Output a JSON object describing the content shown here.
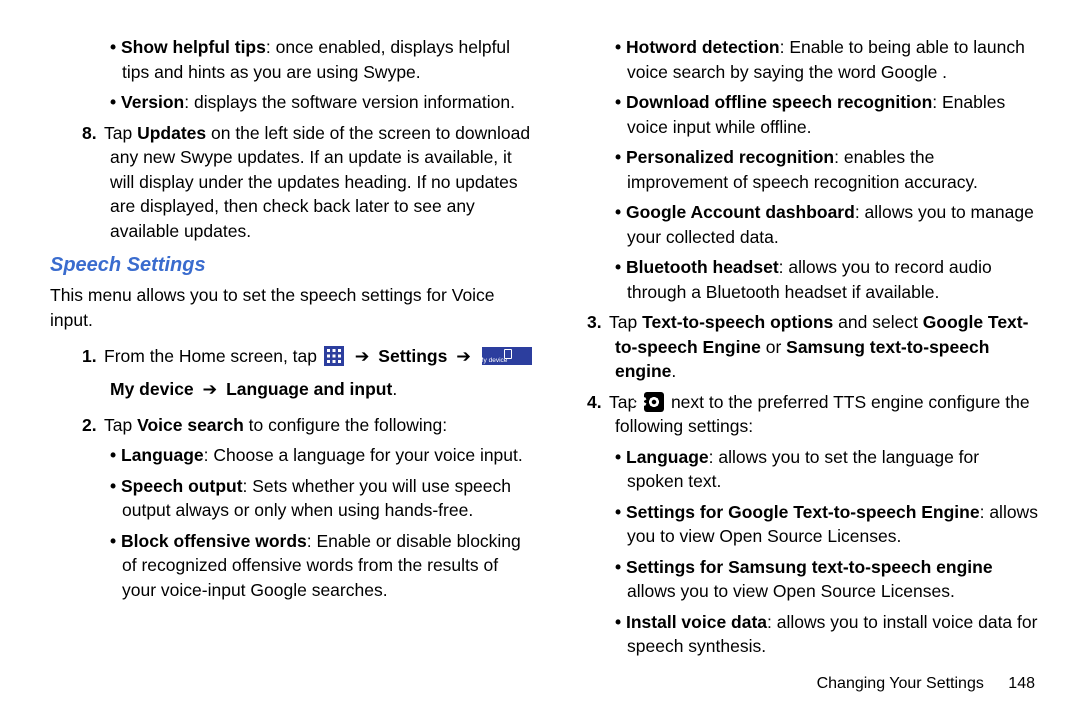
{
  "left": {
    "b1_bold": "Show helpful tips",
    "b1_rest": ": once enabled, displays helpful tips and hints as you are using Swype.",
    "b2_bold": "Version",
    "b2_rest": ": displays the software version information.",
    "n8_num": "8.",
    "n8_a": "Tap ",
    "n8_b": "Updates",
    "n8_c": " on the left side of the screen to download any new Swype updates. If an update is available, it will display under the updates heading. If no updates are displayed, then check back later to see any available updates.",
    "heading": "Speech Settings",
    "intro": "This menu allows you to set the speech settings for Voice input.",
    "n1_num": "1.",
    "n1_a": "From the Home screen, tap ",
    "n1_settings": "Settings",
    "n1_mydevice": "My device",
    "n1_langinput": "Language and input",
    "n2_num": "2.",
    "n2_a": "Tap ",
    "n2_b": "Voice search",
    "n2_c": " to configure the following:",
    "vb1_bold": "Language",
    "vb1_rest": ": Choose a language for your voice input.",
    "vb2_bold": "Speech output",
    "vb2_rest": ": Sets whether you will use speech output always or only when using hands-free.",
    "vb3_bold": "Block offensive words",
    "vb3_rest": ": Enable or disable blocking of recognized offensive words from the results of your voice-input Google searches."
  },
  "right": {
    "rb1_bold": "Hotword detection",
    "rb1_rest": ": Enable to being able to launch voice search by saying the word  Google .",
    "rb2_bold": "Download offline speech recognition",
    "rb2_rest": ": Enables voice input while offline.",
    "rb3_bold": "Personalized recognition",
    "rb3_rest": ": enables the improvement of speech recognition accuracy.",
    "rb4_bold": "Google Account dashboard",
    "rb4_rest": ": allows you to manage your collected data.",
    "rb5_bold": "Bluetooth headset",
    "rb5_rest": ": allows you to record audio through a Bluetooth headset if available.",
    "n3_num": "3.",
    "n3_a": "Tap ",
    "n3_b": "Text-to-speech options",
    "n3_c": " and select ",
    "n3_d": "Google Text-to-speech Engine",
    "n3_e": " or ",
    "n3_f": "Samsung text-to-speech engine",
    "n3_g": ".",
    "n4_num": "4.",
    "n4_a": "Tap ",
    "n4_b": " next to the preferred TTS engine configure the following settings:",
    "tb1_bold": "Language",
    "tb1_rest": ": allows you to set the language for spoken text.",
    "tb2_bold": "Settings for Google Text-to-speech Engine",
    "tb2_rest": ": allows you to view Open Source Licenses.",
    "tb3_bold": "Settings for Samsung text-to-speech engine",
    "tb3_rest": " allows you to view Open Source Licenses.",
    "tb4_bold": "Install voice data",
    "tb4_rest": ": allows you to install voice data for speech synthesis."
  },
  "footer": {
    "section": "Changing Your Settings",
    "page": "148"
  },
  "icons": {
    "mydevice_label": "My device"
  }
}
